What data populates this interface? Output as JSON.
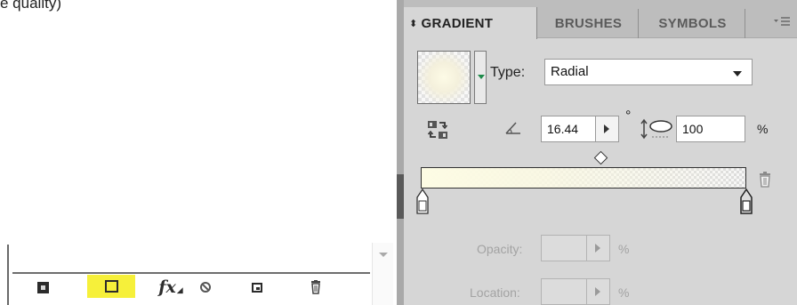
{
  "page_fragment": {
    "top_text": "e quality)"
  },
  "appearance_panel": {
    "icons": [
      "clear-appearance-icon",
      "add-new-fill-icon",
      "fx-icon",
      "clear-icon",
      "duplicate-item-icon",
      "trash-icon"
    ],
    "fx_label": "fx",
    "highlight_color": "#f6f03a"
  },
  "gradient_panel": {
    "tabs": [
      {
        "label": "GRADIENT",
        "active": true
      },
      {
        "label": "BRUSHES",
        "active": false
      },
      {
        "label": "SYMBOLS",
        "active": false
      }
    ],
    "tab_arrows": "⬍",
    "type_label": "Type:",
    "type_value": "Radial",
    "angle_value": "16.44",
    "degree_symbol": "°",
    "aspect_ratio_value": "100",
    "aspect_ratio_unit": "%",
    "opacity_label": "Opacity:",
    "opacity_unit": "%",
    "location_label": "Location:",
    "location_unit": "%",
    "colors": {
      "panel_bg": "#d6d6d6",
      "tab_bar": "#bdbdbd",
      "gradient_start": "#fdfce4",
      "stepper_arrow": "#1e8a4a"
    }
  }
}
